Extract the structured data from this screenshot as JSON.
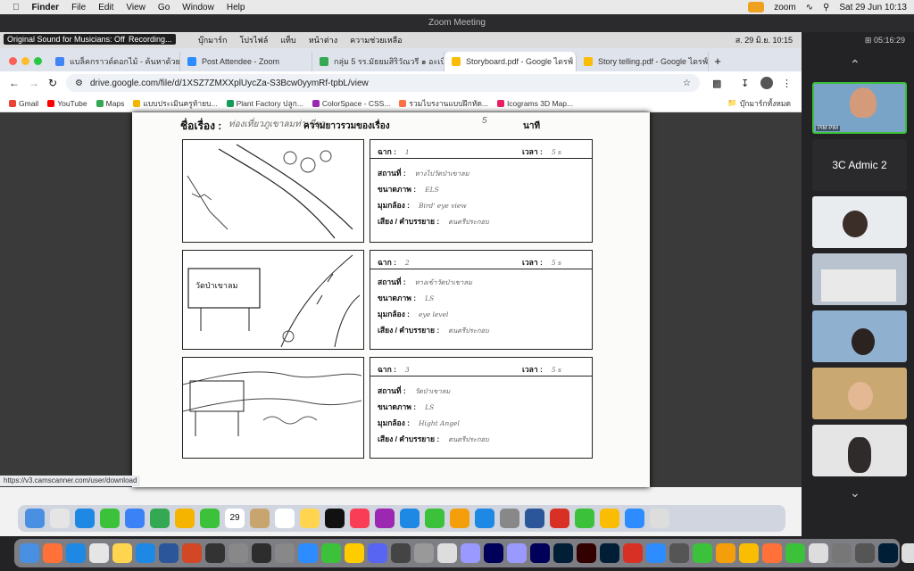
{
  "menubar": {
    "apple": "",
    "app": "Finder",
    "items": [
      "File",
      "Edit",
      "View",
      "Go",
      "Window",
      "Help"
    ],
    "zoom_label": "zoom",
    "datetime": "Sat 29 Jun  10:13"
  },
  "zoom": {
    "title": "Zoom Meeting",
    "timer": "05:16:29",
    "original_sound": "Original Sound for Musicians: Off",
    "recording": "Recording..."
  },
  "shared_menu": {
    "items": [
      "บุ๊กมาร์ก",
      "โปรไฟล์",
      "แท็บ",
      "หน้าต่าง",
      "ความช่วยเหลือ"
    ],
    "datetime": "ส. 29 มิ.ย.  10:15"
  },
  "tabs": [
    {
      "label": "แบล็คกราวด์ดอกไม้ - ค้นหาด้วย",
      "color": "#4285f4"
    },
    {
      "label": "Post Attendee - Zoom",
      "color": "#2d8cff"
    },
    {
      "label": "กลุ่ม 5 รร.มัธยมสิริวัณวรี ๑ อะเบิด",
      "color": "#34a853"
    },
    {
      "label": "Storyboard.pdf - Google ไดรฟ์",
      "color": "#fbbc04"
    },
    {
      "label": "Story telling.pdf - Google ไดรฟ์",
      "color": "#fbbc04"
    }
  ],
  "url": "drive.google.com/file/d/1XSZ7ZMXXplUycZa-S3Bcw0yymRf-tpbL/view",
  "bookmarks": [
    {
      "label": "Gmail",
      "color": "#ea4335"
    },
    {
      "label": "YouTube",
      "color": "#ff0000"
    },
    {
      "label": "Maps",
      "color": "#34a853"
    },
    {
      "label": "แบบประเมินครูท้ายบ...",
      "color": "#f4b400"
    },
    {
      "label": "Plant Factory ปลูก...",
      "color": "#0f9d58"
    },
    {
      "label": "ColorSpace - CSS...",
      "color": "#9c27b0"
    },
    {
      "label": "รวมไบรงานแบบฝึกหัด...",
      "color": "#ff7043"
    },
    {
      "label": "Icograms 3D Map...",
      "color": "#e91e63"
    }
  ],
  "all_bookmarks": "บุ๊กมาร์กทั้งหมด",
  "status_url": "https://v3.camscanner.com/user/download",
  "storyboard": {
    "title_label": "ชื่อเรื่อง :",
    "title_value": "ท่องเที่ยวภูเขาลมท่าเขียว",
    "length_label": "ความยาวรวมของเรื่อง",
    "length_value": "5",
    "length_unit": "นาที",
    "scene_label": "ฉาก :",
    "time_label": "เวลา :",
    "place_label": "สถานที่ :",
    "size_label": "ขนาดภาพ :",
    "angle_label": "มุมกล้อง :",
    "sound_label": "เสียง / คำบรรยาย :",
    "scenes": [
      {
        "no": "1",
        "time": "5 s",
        "place": "ทางไปวัดป่าเขาลม",
        "size": "ELS",
        "angle": "Bird' eye view",
        "sound": "ดนตรีประกอบ"
      },
      {
        "no": "2",
        "time": "5 s",
        "place": "ทางเข้าวัดป่าเขาลม",
        "size": "LS",
        "angle": "eye level",
        "sound": "ดนตรีประกอบ"
      },
      {
        "no": "3",
        "time": "5 s",
        "place": "วัดป่าเขาลม",
        "size": "LS",
        "angle": "Hight Angel",
        "sound": "ดนตรีประกอบ"
      }
    ],
    "sign_text": "วัดป่าเขาลม"
  },
  "participants": [
    {
      "name": "PIM PIM",
      "bg": "#7aa3c8"
    },
    {
      "name": "3C Admic 2",
      "bg": "#2a2a2d"
    },
    {
      "name": "",
      "bg": "#e8ecef"
    },
    {
      "name": "",
      "bg": "#b9c3cf"
    },
    {
      "name": "",
      "bg": "#8fb0cf"
    },
    {
      "name": "",
      "bg": "#c9a872"
    },
    {
      "name": "",
      "bg": "#e5e5e5"
    }
  ],
  "dock_calendar_day": "29"
}
